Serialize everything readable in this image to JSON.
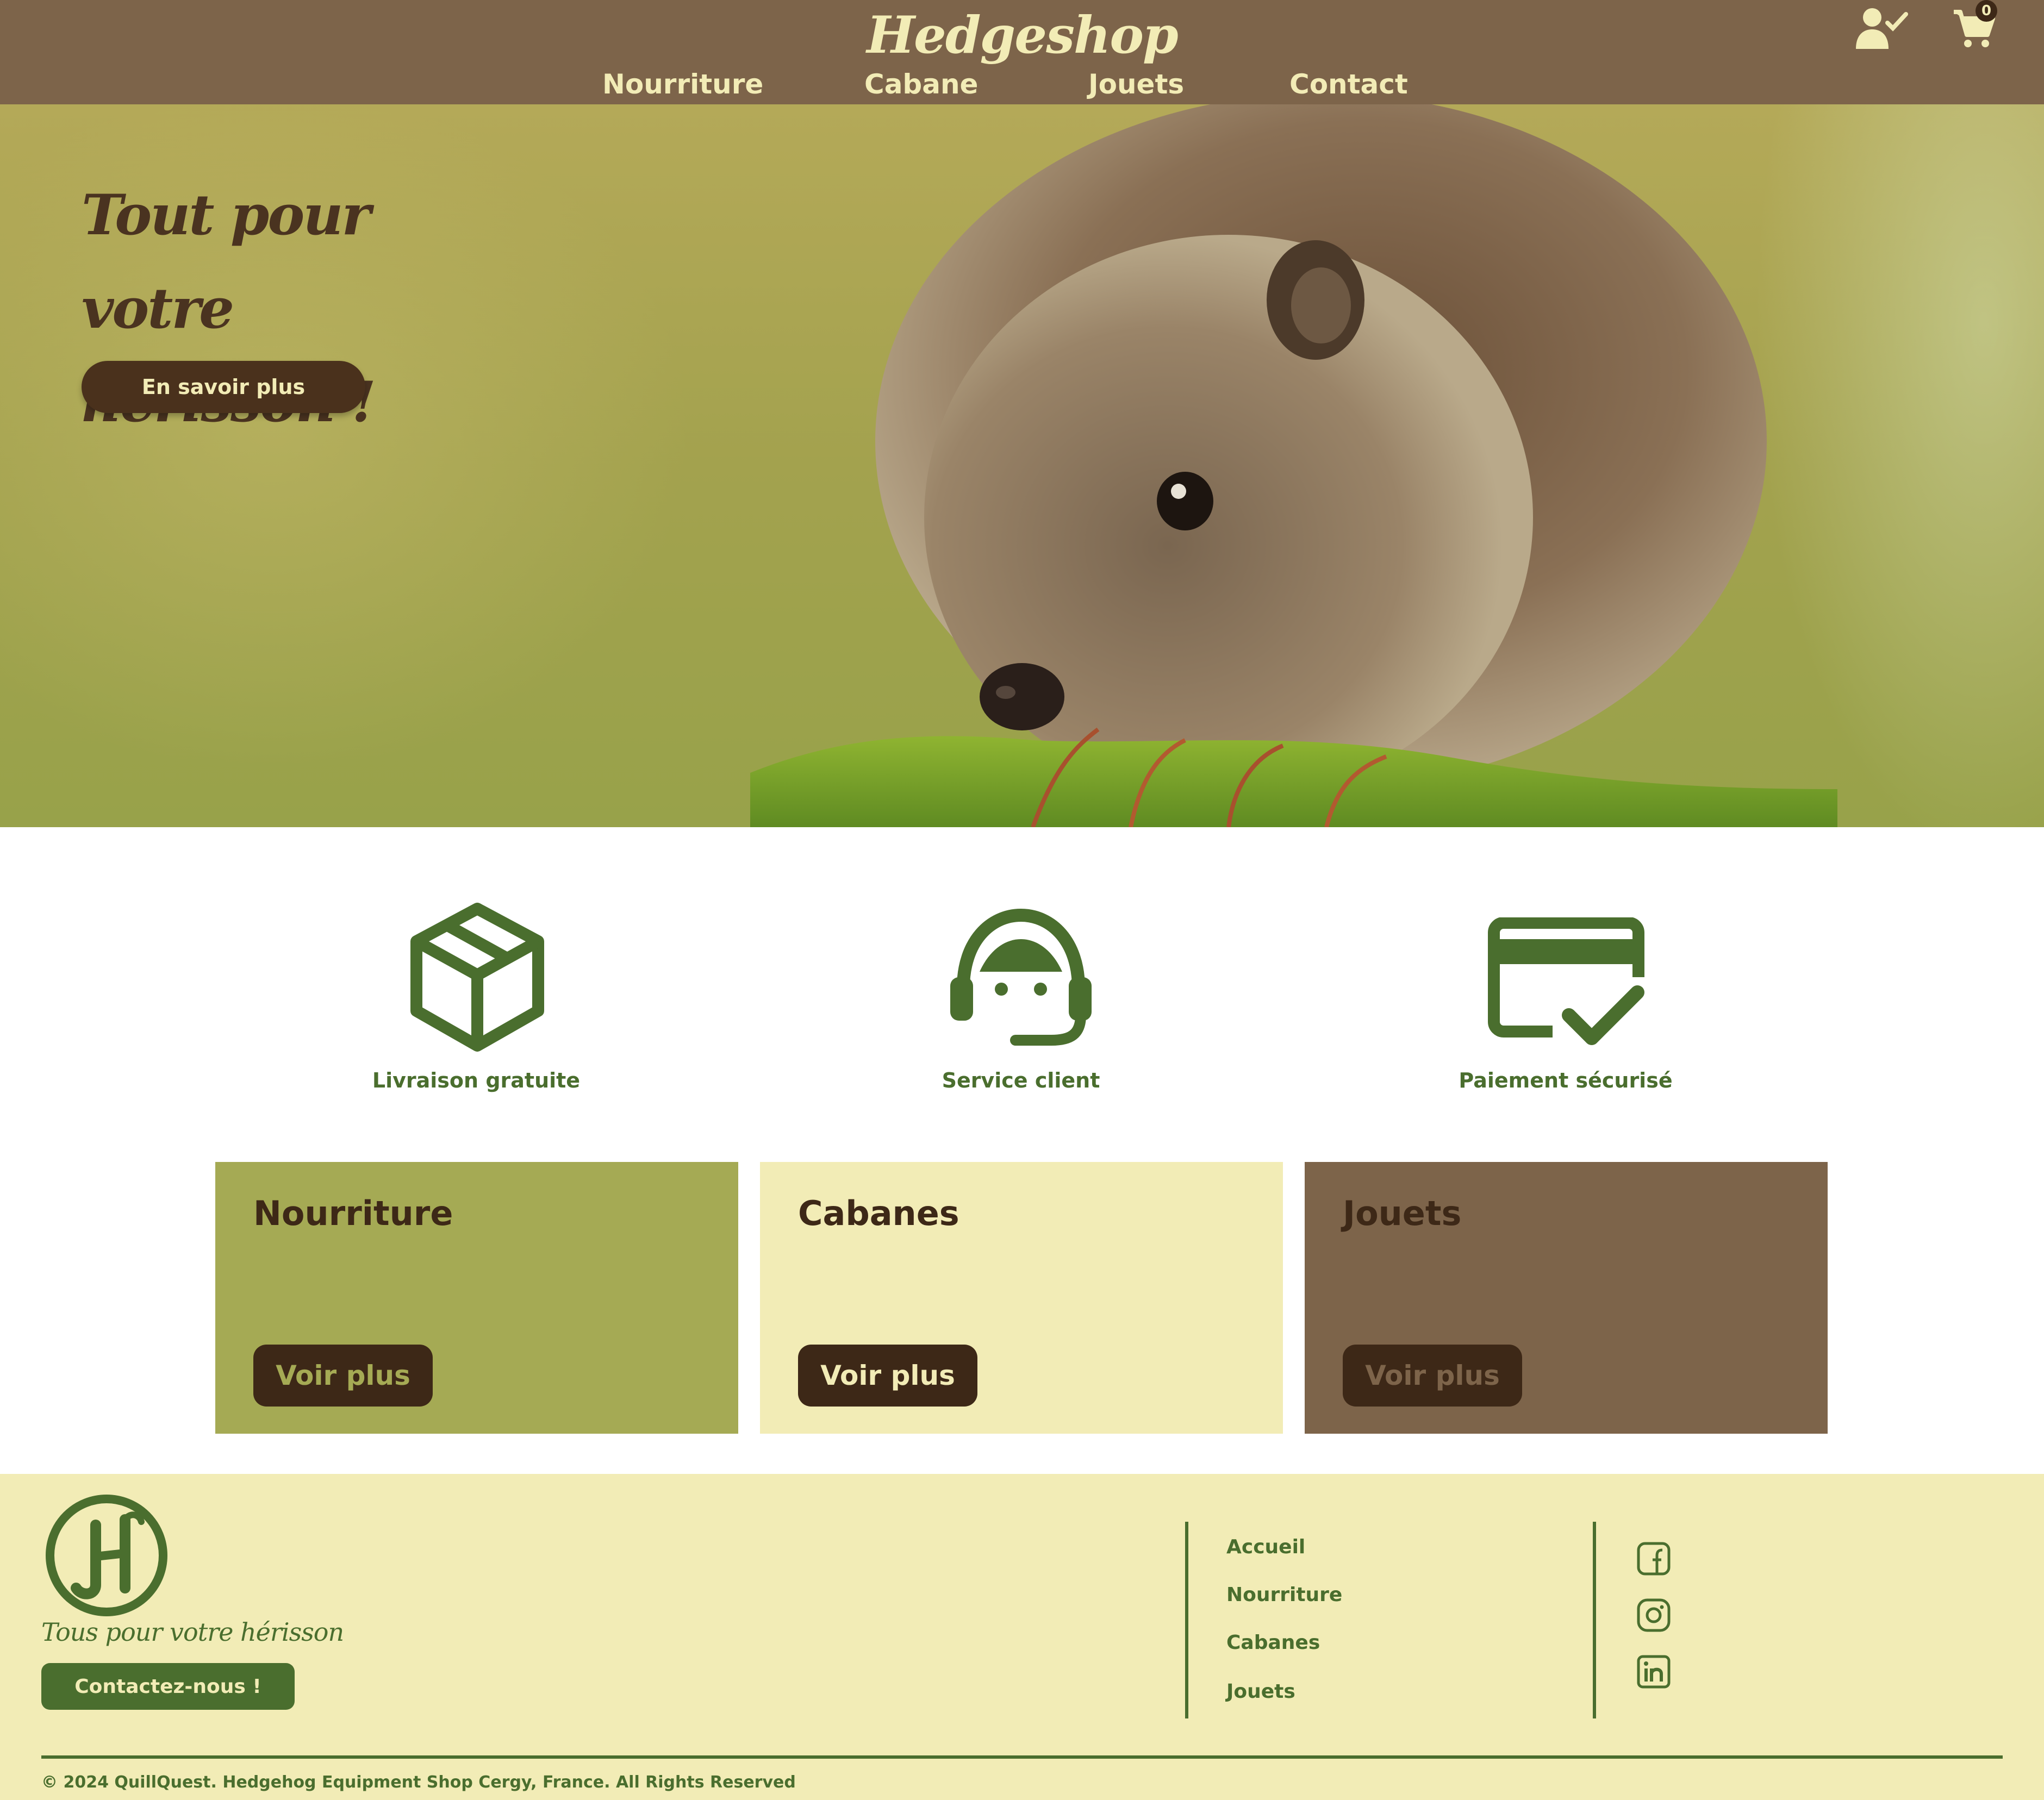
{
  "header": {
    "logo": "Hedgeshop",
    "nav": [
      "Nourriture",
      "Cabane",
      "Jouets",
      "Contact"
    ],
    "cart_count": "0",
    "icons": {
      "account": "user-check-icon",
      "cart": "cart-icon"
    }
  },
  "hero": {
    "title_line1": "Tout pour votre",
    "title_line2": "hérisson !",
    "button": "En savoir plus"
  },
  "features": [
    {
      "label": "Livraison gratuite",
      "icon": "package-icon"
    },
    {
      "label": "Service client",
      "icon": "headset-icon"
    },
    {
      "label": "Paiement sécurisé",
      "icon": "credit-card-check-icon"
    }
  ],
  "categories": [
    {
      "title": "Nourriture",
      "button": "Voir plus",
      "bg": "#a5aa54",
      "button_text_color": "#a5aa54"
    },
    {
      "title": "Cabanes",
      "button": "Voir plus",
      "bg": "#f2ecb6",
      "button_text_color": "#f2ecb6"
    },
    {
      "title": "Jouets",
      "button": "Voir plus",
      "bg": "#7d644a",
      "button_text_color": "#7d644a"
    }
  ],
  "footer": {
    "tagline": "Tous pour votre hérisson",
    "contact_button": "Contactez-nous !",
    "links": [
      "Accueil",
      "Nourriture",
      "Cabanes",
      "Jouets"
    ],
    "social": [
      "facebook-icon",
      "instagram-icon",
      "linkedin-icon"
    ],
    "copyright": "© 2024 QuillQuest. Hedgehog Equipment Shop Cergy, France. All Rights Reserved"
  },
  "colors": {
    "header_bg": "#7d644a",
    "cream": "#f2ecb6",
    "dark_brown": "#3d2817",
    "green": "#4a6e2e",
    "olive": "#a5aa54"
  }
}
